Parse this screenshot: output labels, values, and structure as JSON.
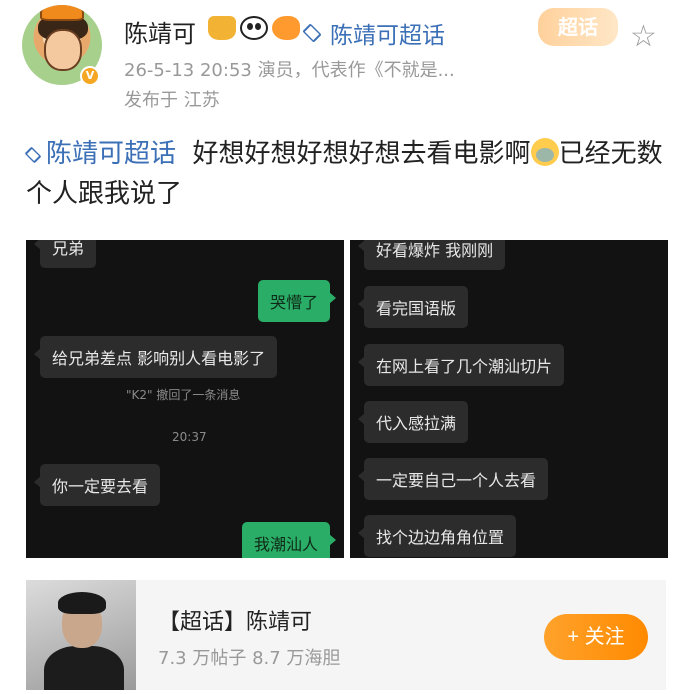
{
  "post": {
    "author": "陈靖可",
    "emoji_badges": [
      "crown-icon",
      "panda-icon",
      "pufferfish-icon"
    ],
    "topic_link": "陈靖可超话",
    "meta": "26-5-13 20:53  演员，代表作《不就是...",
    "location": "发布于 江苏",
    "super_tag": "超话",
    "hashtag": "陈靖可超话",
    "text_before_emoji": "好想好想好想好想去看电影啊",
    "text_after_emoji": "已经无数个人跟我说了"
  },
  "chat_left": {
    "partial_top": "兄弟",
    "msg1": "哭懵了",
    "msg2": "给兄弟差点 影响别人看电影了",
    "recall": "\"K2\" 撤回了一条消息",
    "time": "20:37",
    "msg3": "你一定要去看",
    "msg4": "我潮汕人"
  },
  "chat_right": {
    "msg1": "好看爆炸 我刚刚",
    "msg2": "看完国语版",
    "msg3": "在网上看了几个潮汕切片",
    "msg4": "代入感拉满",
    "msg5": "一定要自己一个人去看",
    "msg6": "找个边边角角位置"
  },
  "card": {
    "title": "【超话】陈靖可",
    "stats": "7.3 万帖子  8.7 万海胆",
    "follow": "+ 关注"
  },
  "colors": {
    "link": "#3b6fb6",
    "accent": "#ff9500",
    "bubble_green": "#2aae67"
  }
}
